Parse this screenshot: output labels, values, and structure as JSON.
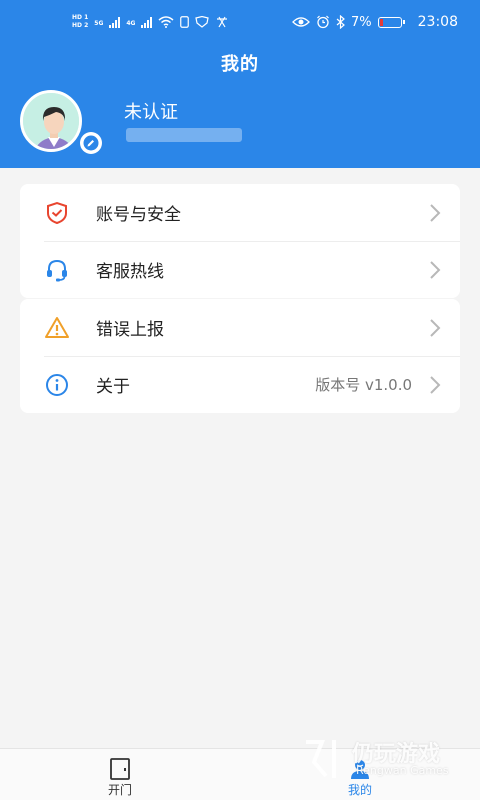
{
  "status_bar": {
    "hd1": "HD 1",
    "hd2": "HD 2",
    "net1": "5G",
    "net2": "4G",
    "battery": "7%",
    "time": "23:08"
  },
  "header": {
    "title": "我的",
    "user_name": "未认证"
  },
  "menu": {
    "items": [
      {
        "label": "账号与安全",
        "icon": "shield-check-icon",
        "value": ""
      },
      {
        "label": "客服热线",
        "icon": "headset-icon",
        "value": ""
      },
      {
        "label": "错误上报",
        "icon": "warning-icon",
        "value": ""
      },
      {
        "label": "关于",
        "icon": "info-icon",
        "value": "版本号 v1.0.0"
      }
    ]
  },
  "tabbar": {
    "tabs": [
      {
        "label": "开门",
        "icon": "door-icon",
        "active": false
      },
      {
        "label": "我的",
        "icon": "profile-icon",
        "active": true
      }
    ]
  },
  "watermark": {
    "text": "仍玩游戏",
    "sub": "Rengwan Games"
  },
  "colors": {
    "primary": "#2b86e8",
    "shield": "#e8452f",
    "warning": "#f0a02a",
    "info": "#2b86e8"
  }
}
